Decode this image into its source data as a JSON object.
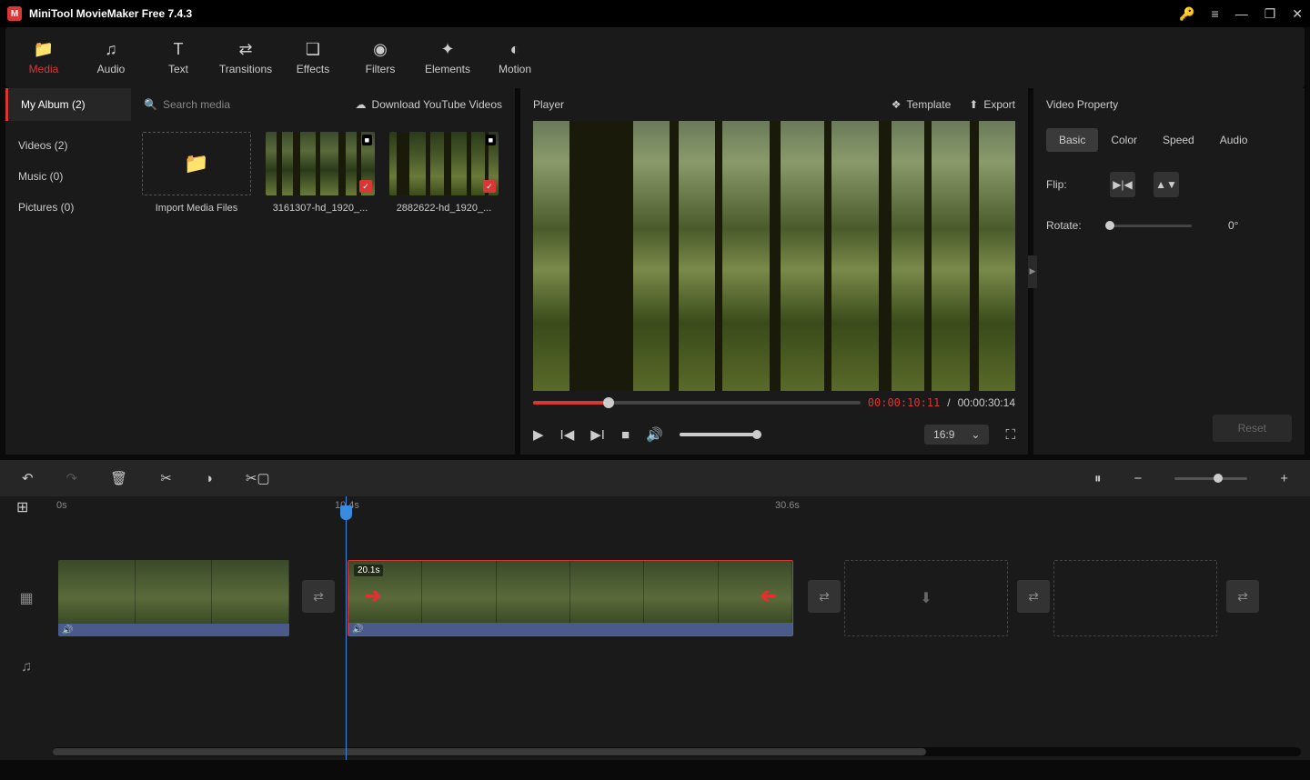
{
  "app": {
    "title": "MiniTool MovieMaker Free 7.4.3"
  },
  "toolbar": {
    "tabs": [
      "Media",
      "Audio",
      "Text",
      "Transitions",
      "Effects",
      "Filters",
      "Elements",
      "Motion"
    ],
    "active": 0
  },
  "album": {
    "title": "My Album (2)",
    "search_placeholder": "Search media",
    "download_yt": "Download YouTube Videos",
    "cats": [
      "Videos (2)",
      "Music (0)",
      "Pictures (0)"
    ],
    "import_label": "Import Media Files",
    "items": [
      {
        "name": "3161307-hd_1920_..."
      },
      {
        "name": "2882622-hd_1920_..."
      }
    ]
  },
  "player": {
    "title": "Player",
    "template": "Template",
    "export": "Export",
    "tc_current": "00:00:10:11",
    "tc_sep": "/",
    "tc_total": "00:00:30:14",
    "aspect": "16:9"
  },
  "props": {
    "title": "Video Property",
    "tabs": [
      "Basic",
      "Color",
      "Speed",
      "Audio"
    ],
    "flip_label": "Flip:",
    "rotate_label": "Rotate:",
    "rotate_value": "0°",
    "reset": "Reset"
  },
  "timeline": {
    "ticks": [
      "0s",
      "10.4s",
      "30.6s"
    ],
    "clip2_dur": "20.1s"
  }
}
